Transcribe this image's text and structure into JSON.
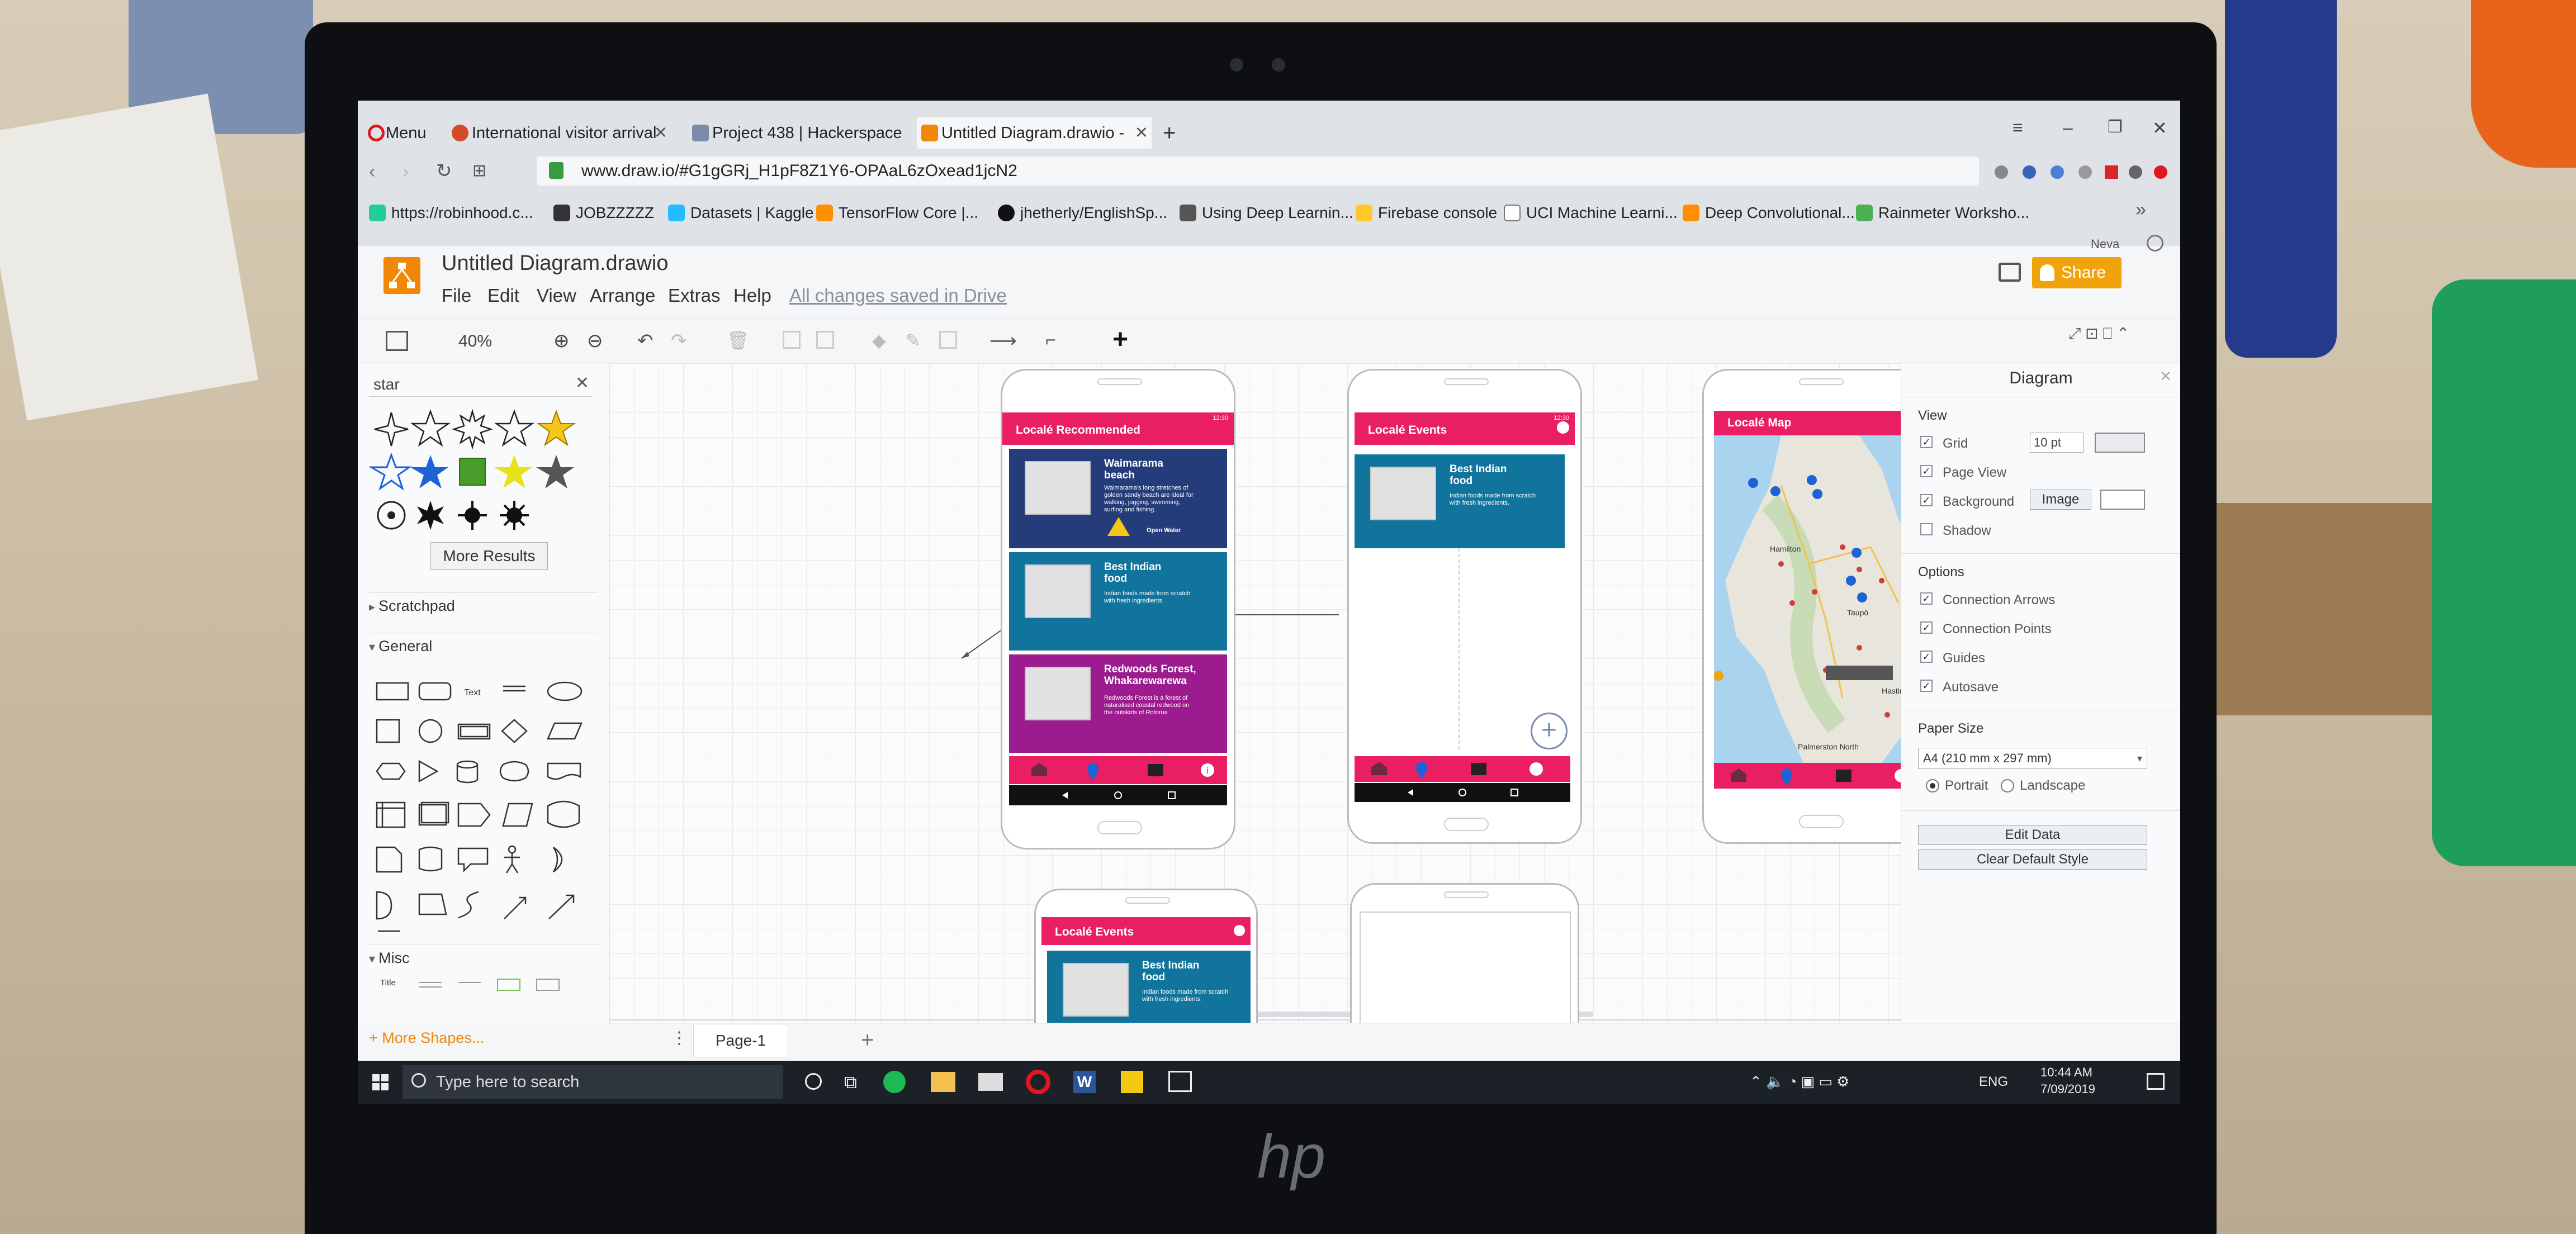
{
  "browser": {
    "tabs": [
      {
        "label": "Menu"
      },
      {
        "label": "International visitor arrival"
      },
      {
        "label": "Project 438 | Hackerspace"
      },
      {
        "label": "Untitled Diagram.drawio -"
      }
    ],
    "url": "www.draw.io/#G1gGRj_H1pF8Z1Y6-OPAaL6zOxead1jcN2",
    "bookmarks": [
      {
        "label": "https://robinhood.c..."
      },
      {
        "label": "JOBZZZZZ"
      },
      {
        "label": "Datasets | Kaggle"
      },
      {
        "label": "TensorFlow Core |..."
      },
      {
        "label": "jhetherly/EnglishSp..."
      },
      {
        "label": "Using Deep Learnin..."
      },
      {
        "label": "Firebase console"
      },
      {
        "label": "UCI Machine Learni..."
      },
      {
        "label": "Deep Convolutional..."
      },
      {
        "label": "Rainmeter Worksho..."
      }
    ]
  },
  "app": {
    "title": "Untitled Diagram.drawio",
    "menu": [
      "File",
      "Edit",
      "View",
      "Arrange",
      "Extras",
      "Help"
    ],
    "save_status": "All changes saved in Drive",
    "share_label": "Share",
    "user": "Neva",
    "zoom": "40%"
  },
  "left_panel": {
    "search_value": "star",
    "more_results": "More Results",
    "sections": [
      "Scratchpad",
      "General",
      "Misc"
    ],
    "text_shape_label": "Text",
    "misc_title_label": "Title",
    "more_shapes": "+ More Shapes..."
  },
  "canvas": {
    "phones": [
      {
        "title": "Localé Recommended",
        "time": "12:30",
        "cards": [
          {
            "title": "Waimarama beach",
            "desc": "Waimarama's long stretches of golden sandy beach are ideal for walking, jogging, swimming, surfing and fishing.",
            "note": "Open Water"
          },
          {
            "title": "Best Indian food",
            "desc": "Indian foods made from scratch with fresh ingredients."
          },
          {
            "title": "Redwoods Forest, Whakarewarewa",
            "desc": "Redwoods Forest is a forest of naturalised coastal redwood on the outskirts of Rotorua"
          }
        ]
      },
      {
        "title": "Localé Events",
        "time": "12:30",
        "cards": [
          {
            "title": "Best Indian food",
            "desc": "Indian foods made from scratch with fresh ingredients."
          }
        ]
      },
      {
        "title": "Localé Map",
        "map_places": [
          "Hamilton",
          "Taupō",
          "Hastings",
          "Palmerston North"
        ]
      },
      {
        "title": "Localé Events",
        "cards": [
          {
            "title": "Best Indian food",
            "desc": "Indian foods made from scratch with fresh ingredients."
          }
        ]
      }
    ]
  },
  "right_panel": {
    "title": "Diagram",
    "view_heading": "View",
    "grid_label": "Grid",
    "grid_value": "10 pt",
    "page_view": "Page View",
    "background": "Background",
    "image_button": "Image",
    "shadow": "Shadow",
    "options_heading": "Options",
    "options": [
      "Connection Arrows",
      "Connection Points",
      "Guides",
      "Autosave"
    ],
    "paper_heading": "Paper Size",
    "paper_value": "A4 (210 mm x 297 mm)",
    "portrait": "Portrait",
    "landscape": "Landscape",
    "edit_data": "Edit Data",
    "clear_style": "Clear Default Style"
  },
  "page_tabs": {
    "page": "Page-1",
    "add": "+"
  },
  "taskbar": {
    "search_placeholder": "Type here to search",
    "lang": "ENG",
    "time": "10:44 AM",
    "date": "7/09/2019"
  },
  "brand": "hp",
  "colors": {
    "accent": "#e91e63",
    "card_navy": "#243c7a",
    "card_teal": "#11749d",
    "card_purple": "#9c1b8e",
    "share": "#f0a30a",
    "drawio_orange": "#f08705"
  }
}
